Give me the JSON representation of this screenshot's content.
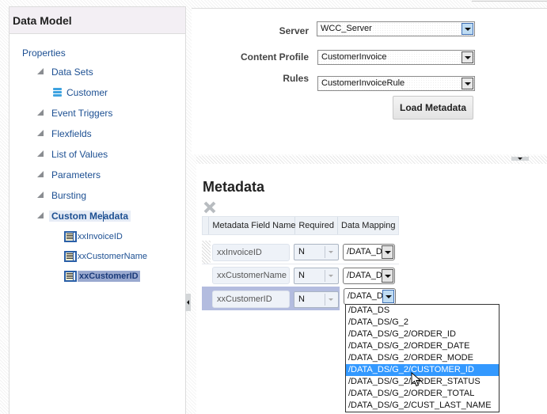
{
  "left_panel": {
    "title": "Data Model",
    "tree": {
      "root": "Properties",
      "items": [
        {
          "label": "Data Sets",
          "expanded": true
        },
        {
          "label": "Customer",
          "icon": "database-icon"
        },
        {
          "label": "Event Triggers",
          "expanded": true
        },
        {
          "label": "Flexfields",
          "expanded": true
        },
        {
          "label": "List of Values",
          "expanded": true
        },
        {
          "label": "Parameters",
          "expanded": true
        },
        {
          "label": "Bursting",
          "expanded": true
        },
        {
          "label_pre": "Custom Me",
          "label_post": "adata",
          "label": "Custom Metadata",
          "expanded": true,
          "selected": true
        }
      ],
      "fields": [
        {
          "label": "xxInvoiceID",
          "icon": "metadata-field-icon"
        },
        {
          "label": "xxCustomerName",
          "icon": "metadata-field-icon"
        },
        {
          "label": "xxCustomerID",
          "icon": "metadata-field-icon",
          "selected": true
        }
      ]
    }
  },
  "form": {
    "server_label": "Server",
    "server_value": "WCC_Server",
    "content_profile_label": "Content Profile",
    "content_profile_value": "CustomerInvoice",
    "rules_label": "Rules",
    "rules_value": "CustomerInvoiceRule",
    "load_button": "Load Metadata"
  },
  "metadata": {
    "title": "Metadata",
    "delete_icon": "delete-x-icon",
    "columns": [
      "Metadata Field Name",
      "Required",
      "Data Mapping"
    ],
    "rows": [
      {
        "field": "xxInvoiceID",
        "required": "N",
        "mapping": "/DATA_D"
      },
      {
        "field": "xxCustomerName",
        "required": "N",
        "mapping": "/DATA_D"
      },
      {
        "field": "xxCustomerID",
        "required": "N",
        "mapping": "/DATA_D",
        "selected": true
      }
    ],
    "dropdown_options": [
      "/DATA_DS",
      "/DATA_DS/G_2",
      "/DATA_DS/G_2/ORDER_ID",
      "/DATA_DS/G_2/ORDER_DATE",
      "/DATA_DS/G_2/ORDER_MODE",
      "/DATA_DS/G_2/CUSTOMER_ID",
      "/DATA_DS/G_2/ORDER_STATUS",
      "/DATA_DS/G_2/ORDER_TOTAL",
      "/DATA_DS/G_2/CUST_LAST_NAME"
    ],
    "dropdown_highlighted": "/DATA_DS/G_2/CUSTOMER_ID"
  },
  "colors": {
    "link_blue": "#1c4f92",
    "selection_bg": "#9aa9cf",
    "highlight": "#3399ff"
  }
}
